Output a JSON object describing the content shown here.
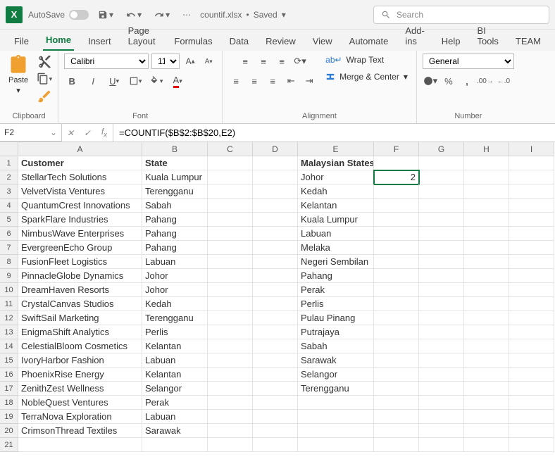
{
  "qat": {
    "autosave_label": "AutoSave",
    "autosave_state": "Off",
    "filename": "countif.xlsx",
    "saved": "Saved"
  },
  "search": {
    "placeholder": "Search"
  },
  "tabs": [
    "File",
    "Home",
    "Insert",
    "Page Layout",
    "Formulas",
    "Data",
    "Review",
    "View",
    "Automate",
    "Add-ins",
    "Help",
    "BI Tools",
    "TEAM"
  ],
  "active_tab": "Home",
  "ribbon": {
    "clipboard": {
      "paste": "Paste",
      "label": "Clipboard"
    },
    "font": {
      "name": "Calibri",
      "size": "11",
      "label": "Font"
    },
    "alignment": {
      "wrap": "Wrap Text",
      "merge": "Merge & Center",
      "label": "Alignment"
    },
    "number": {
      "format": "General",
      "label": "Number"
    }
  },
  "formula": {
    "name_box": "F2",
    "value": "=COUNTIF($B$2:$B$20,E2)"
  },
  "columns": [
    "A",
    "B",
    "C",
    "D",
    "E",
    "F",
    "G",
    "H",
    "I"
  ],
  "rows": [
    1,
    2,
    3,
    4,
    5,
    6,
    7,
    8,
    9,
    10,
    11,
    12,
    13,
    14,
    15,
    16,
    17,
    18,
    19,
    20,
    21
  ],
  "headers": {
    "A": "Customer",
    "B": "State",
    "E": "Malaysian States"
  },
  "data": {
    "customers": [
      "StellarTech Solutions",
      "VelvetVista Ventures",
      "QuantumCrest Innovations",
      "SparkFlare Industries",
      "NimbusWave Enterprises",
      "EvergreenEcho Group",
      "FusionFleet Logistics",
      "PinnacleGlobe Dynamics",
      "DreamHaven Resorts",
      "CrystalCanvas Studios",
      "SwiftSail Marketing",
      "EnigmaShift Analytics",
      "CelestialBloom Cosmetics",
      "IvoryHarbor Fashion",
      "PhoenixRise Energy",
      "ZenithZest Wellness",
      "NobleQuest Ventures",
      "TerraNova Exploration",
      "CrimsonThread Textiles"
    ],
    "states": [
      "Kuala Lumpur",
      "Terengganu",
      "Sabah",
      "Pahang",
      "Pahang",
      "Pahang",
      "Labuan",
      "Johor",
      "Johor",
      "Kedah",
      "Terengganu",
      "Perlis",
      "Kelantan",
      "Labuan",
      "Kelantan",
      "Selangor",
      "Perak",
      "Labuan",
      "Sarawak"
    ],
    "malaysian_states": [
      "Johor",
      "Kedah",
      "Kelantan",
      "Kuala Lumpur",
      "Labuan",
      "Melaka",
      "Negeri Sembilan",
      "Pahang",
      "Perak",
      "Perlis",
      "Pulau Pinang",
      "Putrajaya",
      "Sabah",
      "Sarawak",
      "Selangor",
      "Terengganu"
    ],
    "f2": "2"
  }
}
